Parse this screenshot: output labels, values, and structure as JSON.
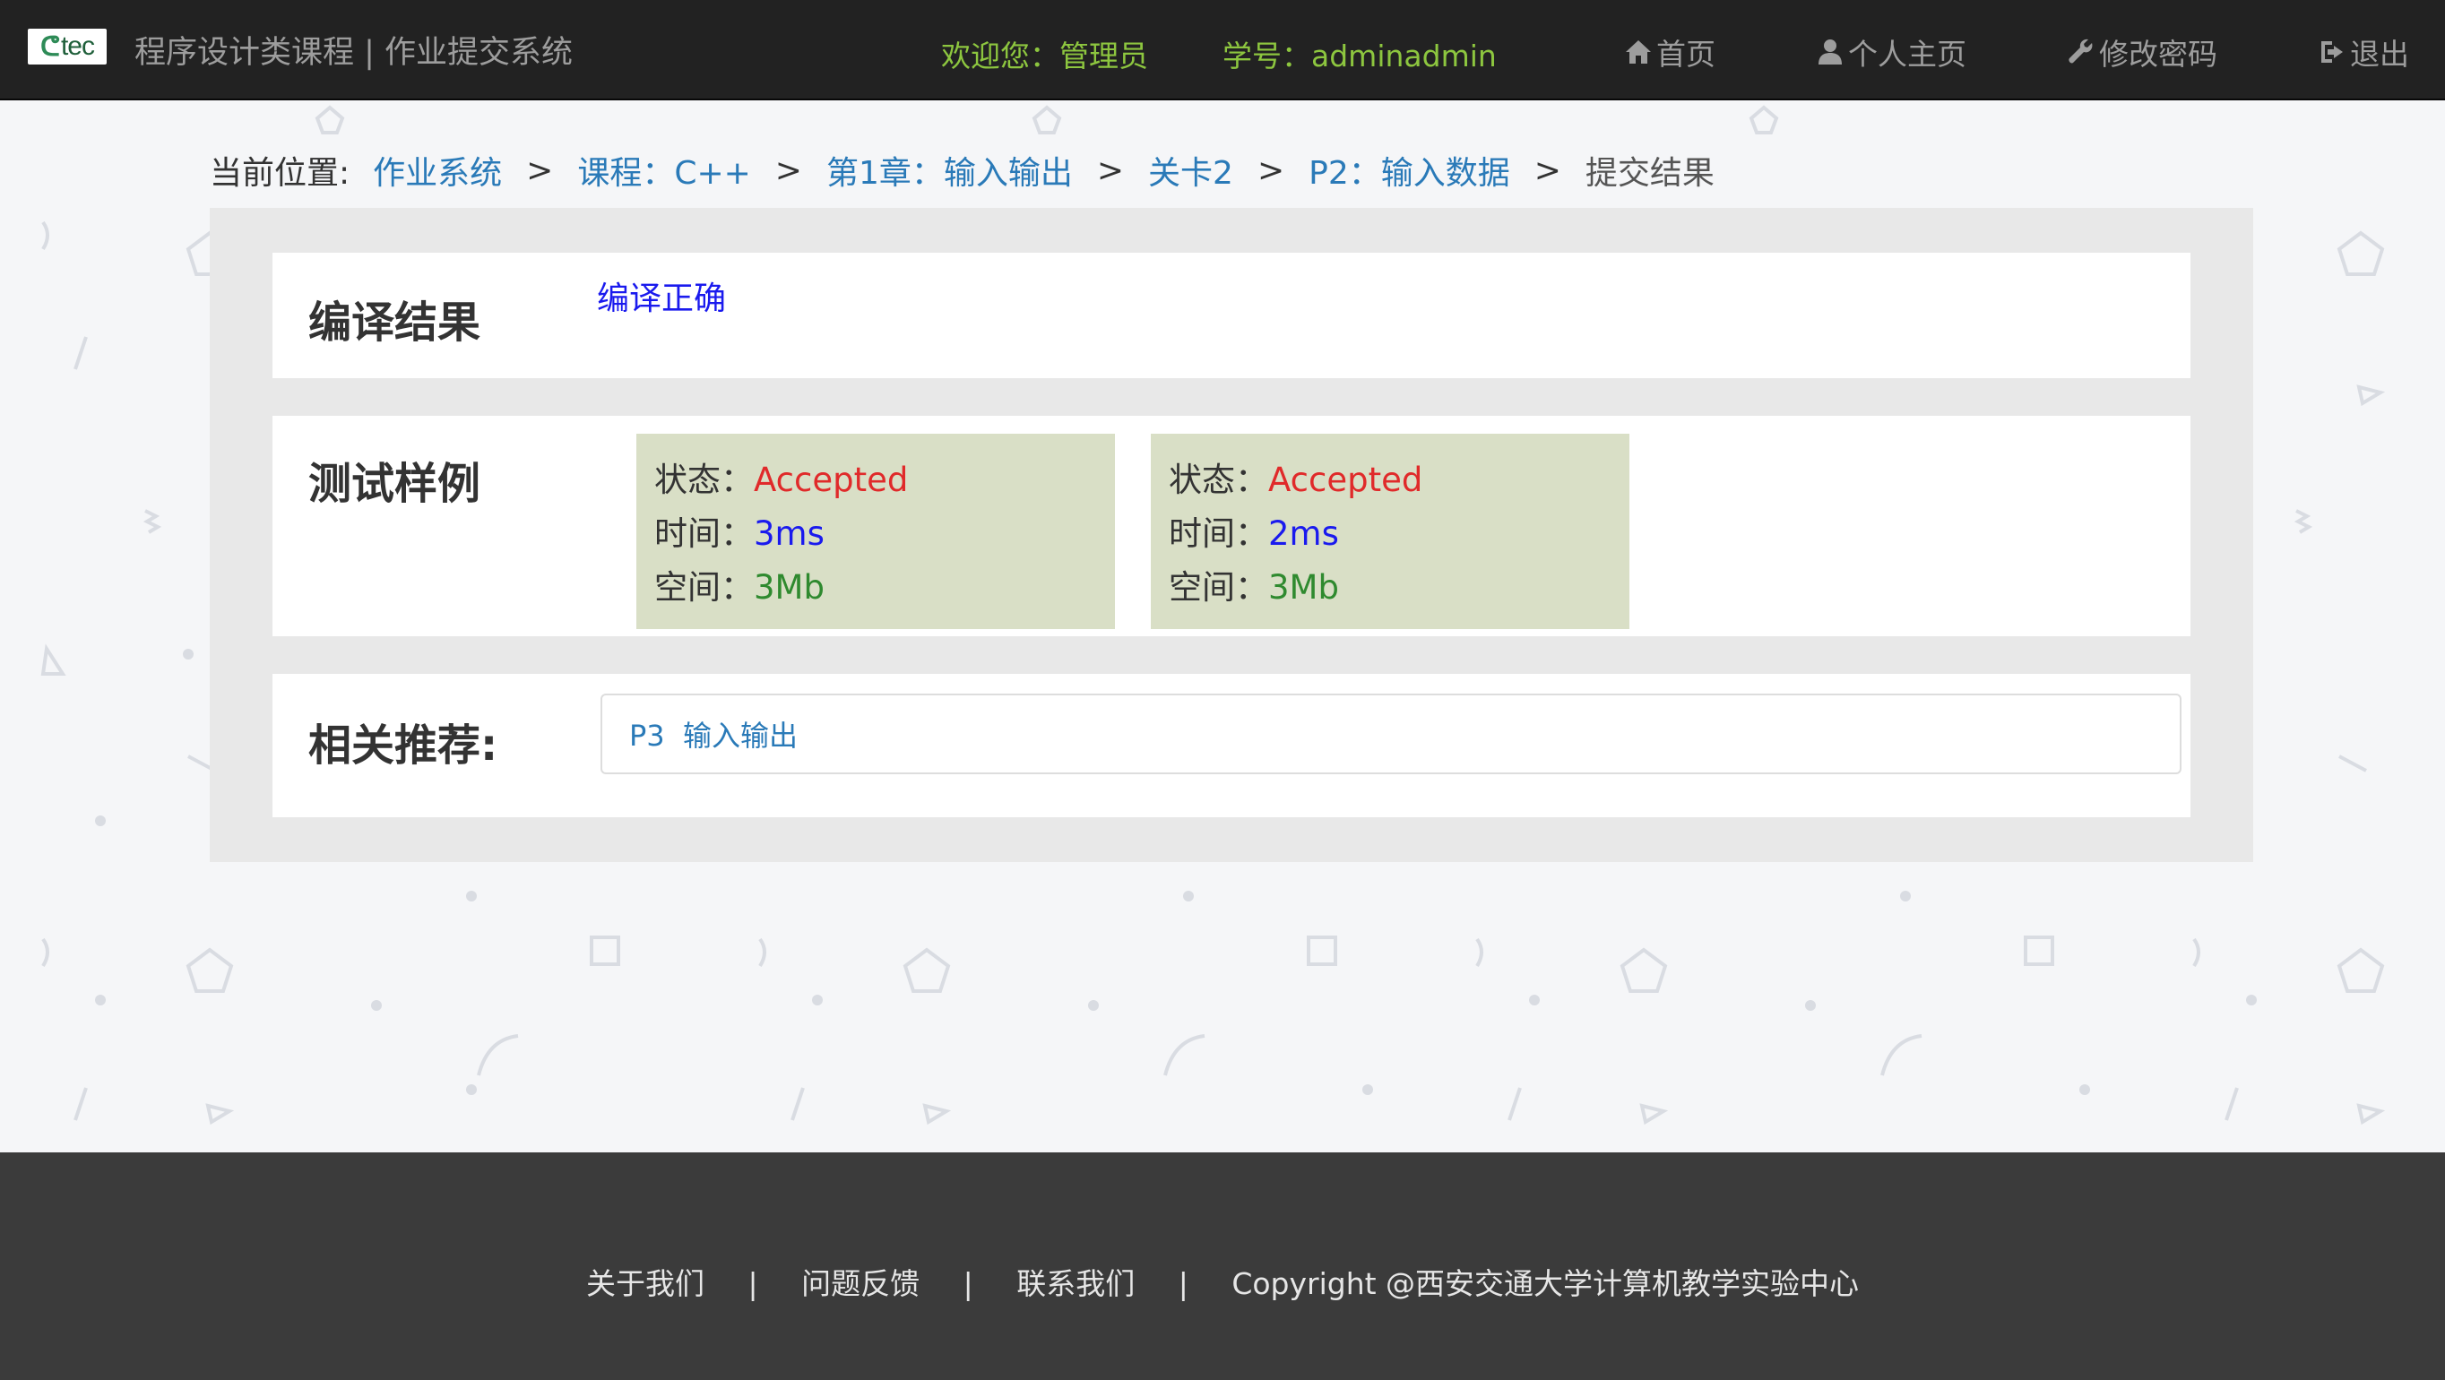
{
  "navbar": {
    "logo_text": "tec",
    "system_title": "程序设计类课程 | 作业提交系统",
    "welcome": "欢迎您：管理员",
    "student_id": "学号：adminadmin",
    "home": "首页",
    "profile": "个人主页",
    "change_password": "修改密码",
    "logout": "退出"
  },
  "breadcrumb": {
    "label": "当前位置:",
    "items": [
      "作业系统",
      "课程：C++",
      "第1章：输入输出",
      "关卡2",
      "P2：输入数据"
    ],
    "separator": ">",
    "current": "提交结果"
  },
  "compile": {
    "title": "编译结果",
    "result": "编译正确"
  },
  "tests": {
    "title": "测试样例",
    "status_label": "状态：",
    "time_label": "时间：",
    "space_label": "空间：",
    "cases": [
      {
        "status": "Accepted",
        "time": "3ms",
        "space": "3Mb"
      },
      {
        "status": "Accepted",
        "time": "2ms",
        "space": "3Mb"
      }
    ]
  },
  "recommend": {
    "title": "相关推荐:",
    "link": "P3  输入输出"
  },
  "footer": {
    "about": "关于我们",
    "feedback": "问题反馈",
    "contact": "联系我们",
    "separator": "|",
    "copyright": "Copyright @西安交通大学计算机教学实验中心"
  },
  "colors": {
    "navbar_bg": "#222222",
    "welcome_green": "#8dc63f",
    "link_blue": "#2a7ab8",
    "accepted_red": "#e02a2a",
    "time_blue": "#1a1aee",
    "space_green": "#2f8a2f",
    "case_bg": "#d9dfc6",
    "footer_bg": "#3b3b3b"
  }
}
